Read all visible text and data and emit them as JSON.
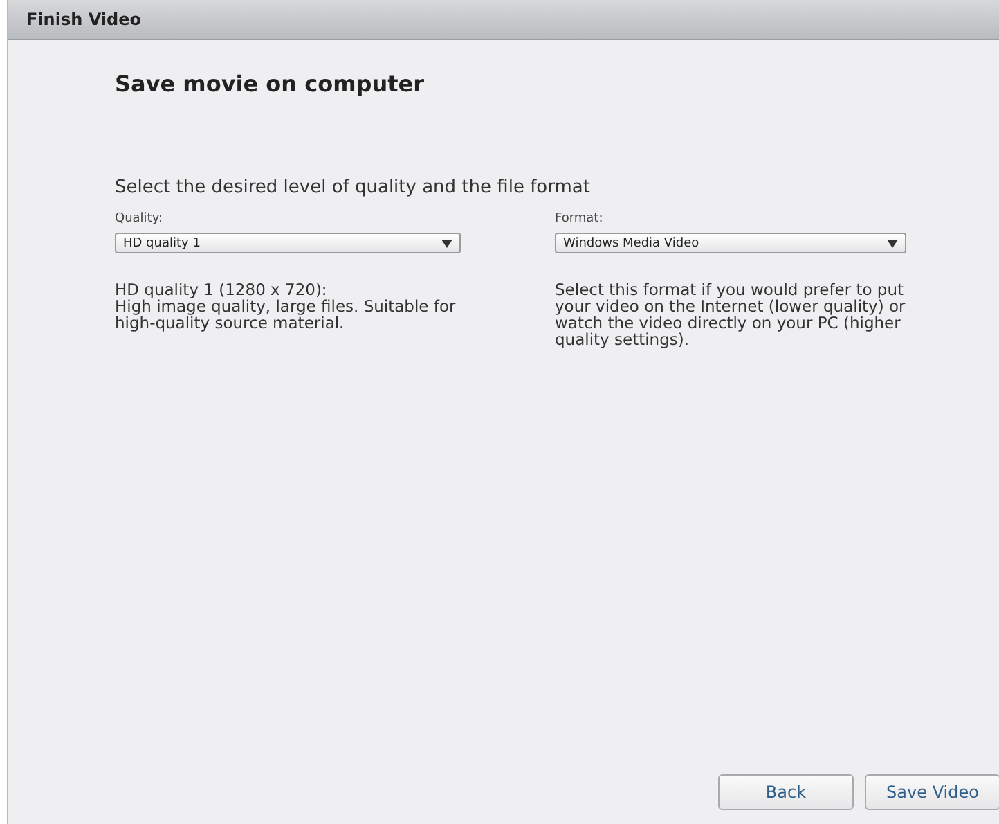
{
  "window": {
    "title": "Finish Video"
  },
  "heading": "Save movie on computer",
  "instruction": "Select the desired level of quality and the file format",
  "fields": [
    {
      "label": "Quality:",
      "value": "HD quality 1",
      "description": "HD quality 1 (1280 x 720):\nHigh image quality, large files. Suitable for\nhigh-quality source material."
    },
    {
      "label": "Format:",
      "value": "Windows Media Video",
      "description": "Select this format if you would prefer to put\nyour video on the Internet (lower quality) or\nwatch the video directly on your PC (higher\nquality settings)."
    }
  ],
  "buttons": [
    "Back",
    "Save Video"
  ]
}
